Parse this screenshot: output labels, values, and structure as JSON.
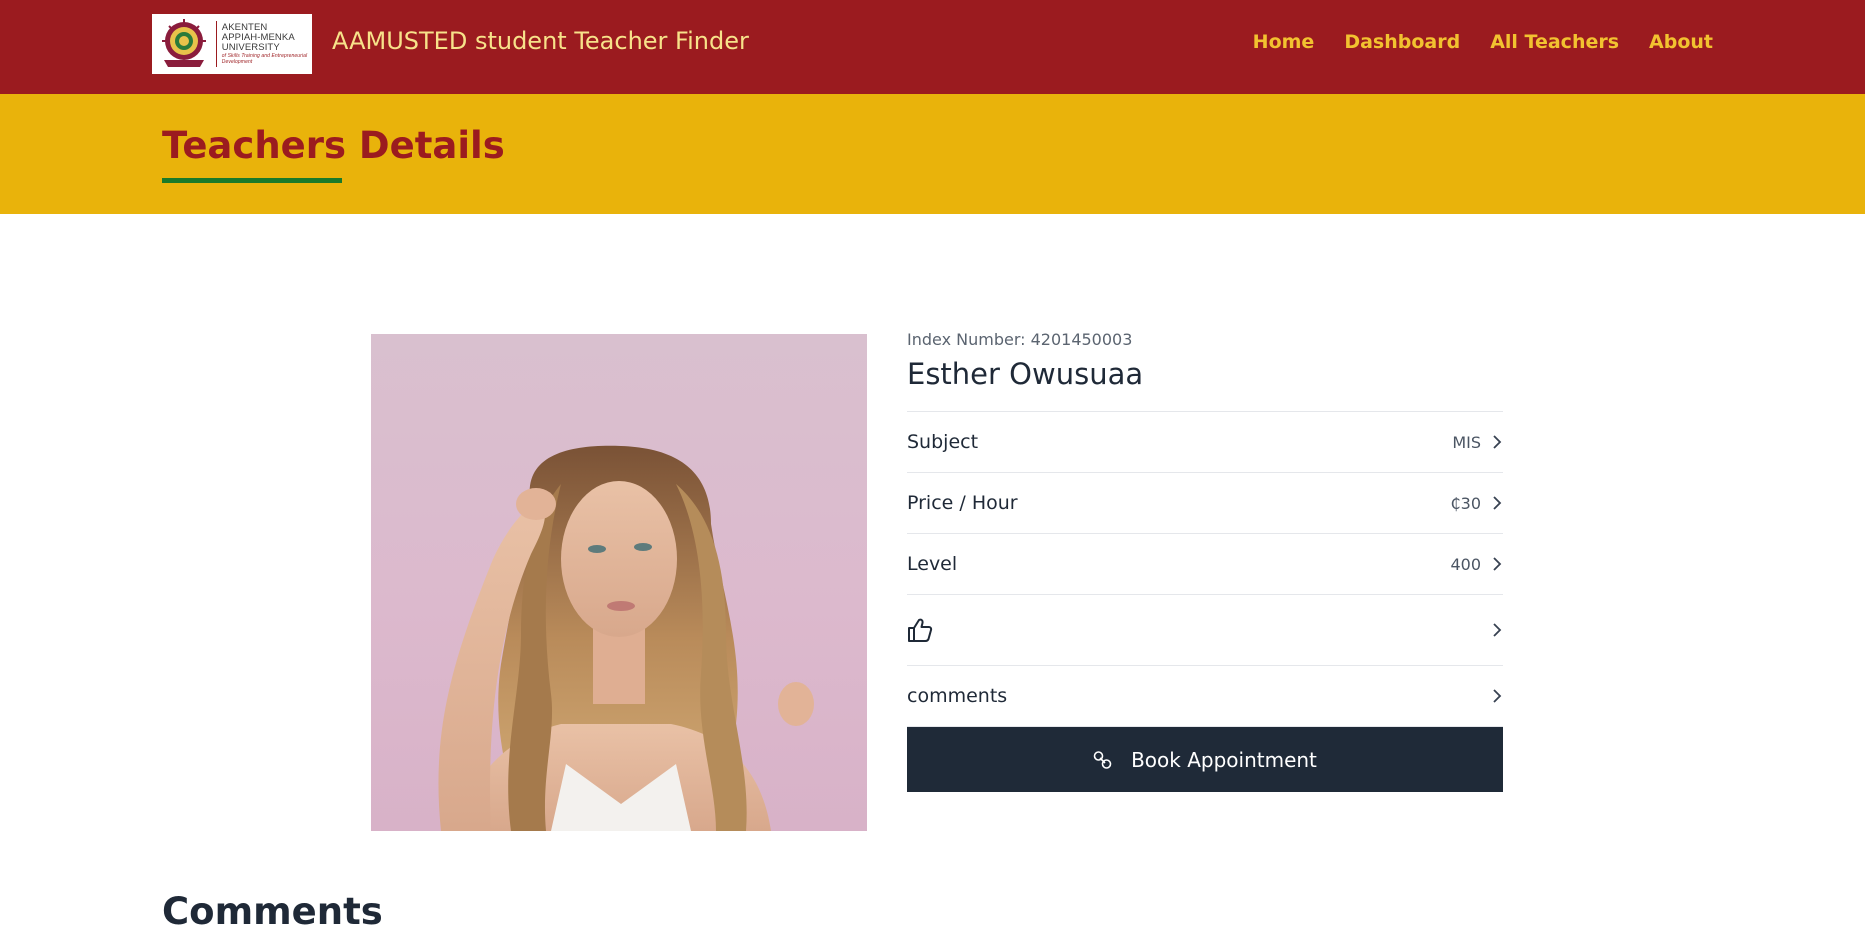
{
  "navbar": {
    "logo_lines": [
      "AKENTEN",
      "APPIAH-MENKA",
      "UNIVERSITY"
    ],
    "logo_tagline": "of Skills Training and Entrepreneurial Development",
    "brand": "AAMUSTED student Teacher Finder",
    "links": [
      "Home",
      "Dashboard",
      "All Teachers",
      "About"
    ]
  },
  "banner": {
    "title": "Teachers Details"
  },
  "teacher": {
    "index_number": "Index Number: 4201450003",
    "name": "Esther Owusuaa",
    "photo_icon": "teacher-photo"
  },
  "details": {
    "subject_label": "Subject",
    "subject_value": "MIS",
    "price_label": "Price / Hour",
    "price_value": "₵30",
    "level_label": "Level",
    "level_value": "400",
    "like_icon": "thumbs-up-icon",
    "comments_label": "comments"
  },
  "book_button": {
    "label": "Book Appointment",
    "icon": "link-icon"
  },
  "comments_section": {
    "heading": "Comments"
  },
  "colors": {
    "navbar": "#9b1b1f",
    "brand_text": "#f7e28a",
    "nav_link": "#f2c230",
    "banner": "#e9b30b",
    "banner_title": "#9b1b1f",
    "underline": "#1a7a2a",
    "button": "#1f2a38"
  }
}
